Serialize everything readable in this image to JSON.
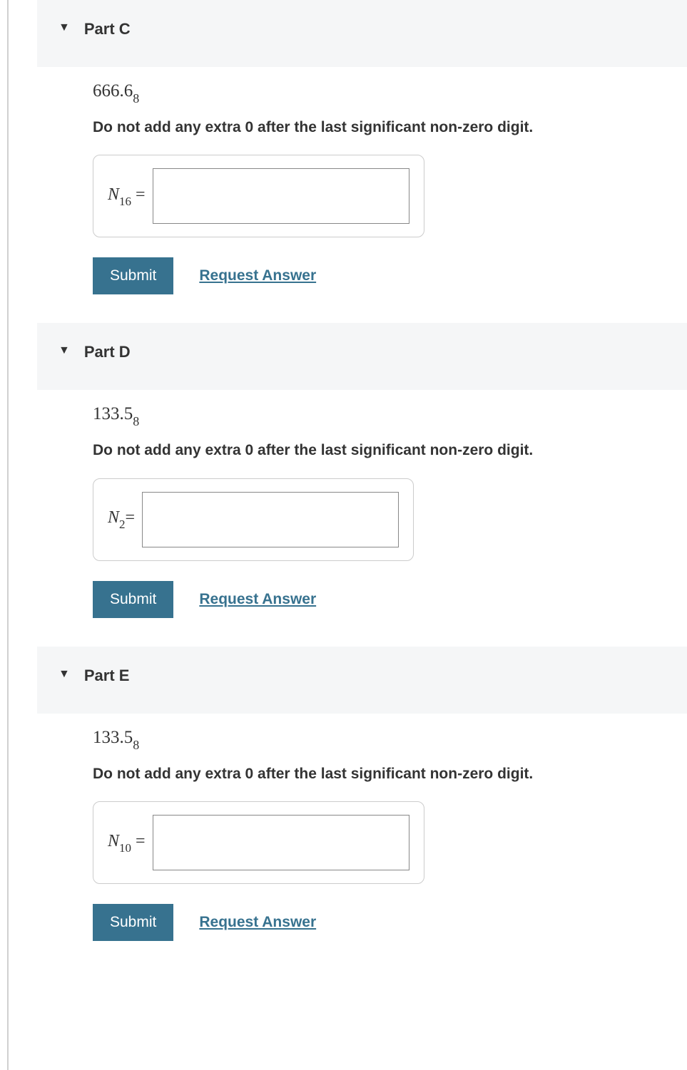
{
  "parts": [
    {
      "title": "Part C",
      "value_main": "666.6",
      "value_sub": "8",
      "instruction": "Do not add any extra 0 after the last significant non-zero digit.",
      "var_letter": "N",
      "var_sub": "16",
      "equals": " =",
      "submit_label": "Submit",
      "request_label": "Request Answer"
    },
    {
      "title": "Part D",
      "value_main": "133.5",
      "value_sub": "8",
      "instruction": "Do not add any extra 0 after the last significant non-zero digit.",
      "var_letter": "N",
      "var_sub": "2",
      "equals": "=",
      "submit_label": "Submit",
      "request_label": "Request Answer"
    },
    {
      "title": "Part E",
      "value_main": "133.5",
      "value_sub": "8",
      "instruction": "Do not add any extra 0 after the last significant non-zero digit.",
      "var_letter": "N",
      "var_sub": "10",
      "equals": " =",
      "submit_label": "Submit",
      "request_label": "Request Answer"
    }
  ]
}
